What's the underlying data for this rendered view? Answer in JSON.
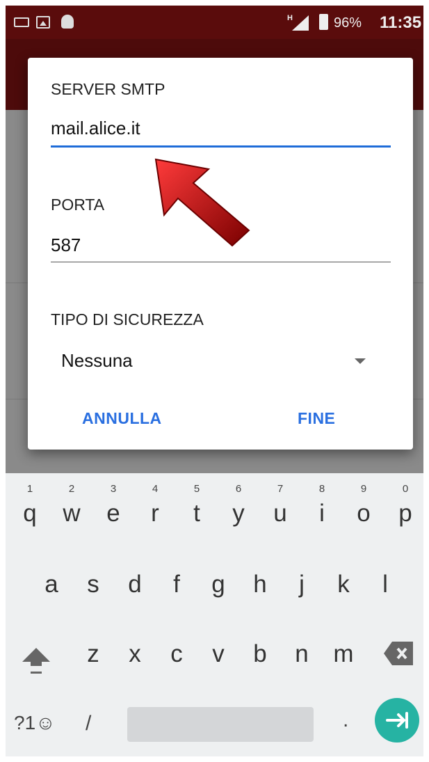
{
  "status_bar": {
    "network": "H",
    "battery": "96%",
    "time": "11:35",
    "icons": [
      "keyboard-icon",
      "image-icon",
      "android-debug-icon",
      "signal-icon",
      "battery-charging-icon"
    ]
  },
  "dialog": {
    "smtp_label": "SERVER SMTP",
    "smtp_value": "mail.alice.it",
    "port_label": "PORTA",
    "port_value": "587",
    "security_label": "TIPO DI SICUREZZA",
    "security_value": "Nessuna",
    "cancel_label": "ANNULLA",
    "done_label": "FINE",
    "accent_color": "#1e6cd8"
  },
  "annotation": {
    "arrow_color": "#c00000",
    "icon": "red-arrow-icon"
  },
  "keyboard": {
    "row1": [
      {
        "key": "q",
        "hint": "1"
      },
      {
        "key": "w",
        "hint": "2"
      },
      {
        "key": "e",
        "hint": "3"
      },
      {
        "key": "r",
        "hint": "4"
      },
      {
        "key": "t",
        "hint": "5"
      },
      {
        "key": "y",
        "hint": "6"
      },
      {
        "key": "u",
        "hint": "7"
      },
      {
        "key": "i",
        "hint": "8"
      },
      {
        "key": "o",
        "hint": "9"
      },
      {
        "key": "p",
        "hint": "0"
      }
    ],
    "row2": [
      "a",
      "s",
      "d",
      "f",
      "g",
      "h",
      "j",
      "k",
      "l"
    ],
    "row3": [
      "z",
      "x",
      "c",
      "v",
      "b",
      "n",
      "m"
    ],
    "symbols_label": "?1☺",
    "slash_label": "/",
    "period_label": ".",
    "enter_color": "#26b3a3"
  }
}
